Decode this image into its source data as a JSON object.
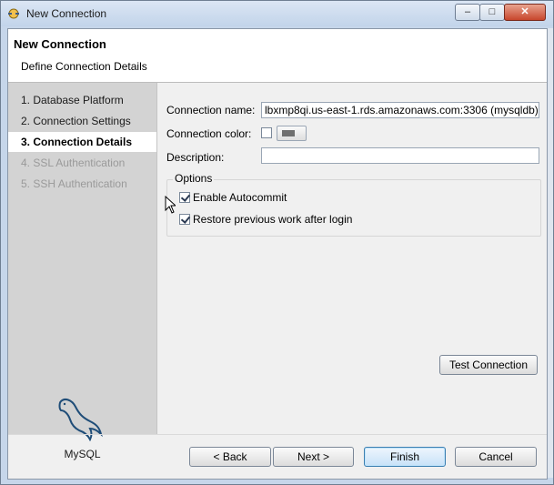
{
  "window": {
    "title": "New Connection",
    "icons": {
      "app": "connection-wizard-icon",
      "minimize": "minimize-icon",
      "maximize": "maximize-icon",
      "close": "close-icon"
    }
  },
  "header": {
    "title": "New Connection",
    "subtitle": "Define Connection Details"
  },
  "steps": [
    {
      "label": "1. Database Platform",
      "state": "done"
    },
    {
      "label": "2. Connection Settings",
      "state": "done"
    },
    {
      "label": "3. Connection Details",
      "state": "active"
    },
    {
      "label": "4. SSL Authentication",
      "state": "disabled"
    },
    {
      "label": "5. SSH Authentication",
      "state": "disabled"
    }
  ],
  "platform": {
    "label": "MySQL",
    "icon": "mysql-dolphin-icon"
  },
  "form": {
    "connection_name_label": "Connection name:",
    "connection_name_value": "lbxmp8qi.us-east-1.rds.amazonaws.com:3306 (mysqldb)",
    "connection_color_label": "Connection color:",
    "connection_color_checked": false,
    "connection_color_value": "#6f6f6f",
    "description_label": "Description:",
    "description_value": "",
    "options_label": "Options",
    "enable_autocommit_label": "Enable Autocommit",
    "enable_autocommit_checked": true,
    "restore_work_label": "Restore previous work after login",
    "restore_work_checked": true
  },
  "buttons": {
    "test_connection": "Test Connection",
    "back": "< Back",
    "next": "Next >",
    "finish": "Finish",
    "cancel": "Cancel"
  },
  "colors": {
    "title_bar": "#c6d6ea",
    "steps_panel": "#d3d3d3",
    "active_step": "#ffffff",
    "disabled_step_text": "#9a9a9a",
    "close_button": "#c7462c"
  }
}
